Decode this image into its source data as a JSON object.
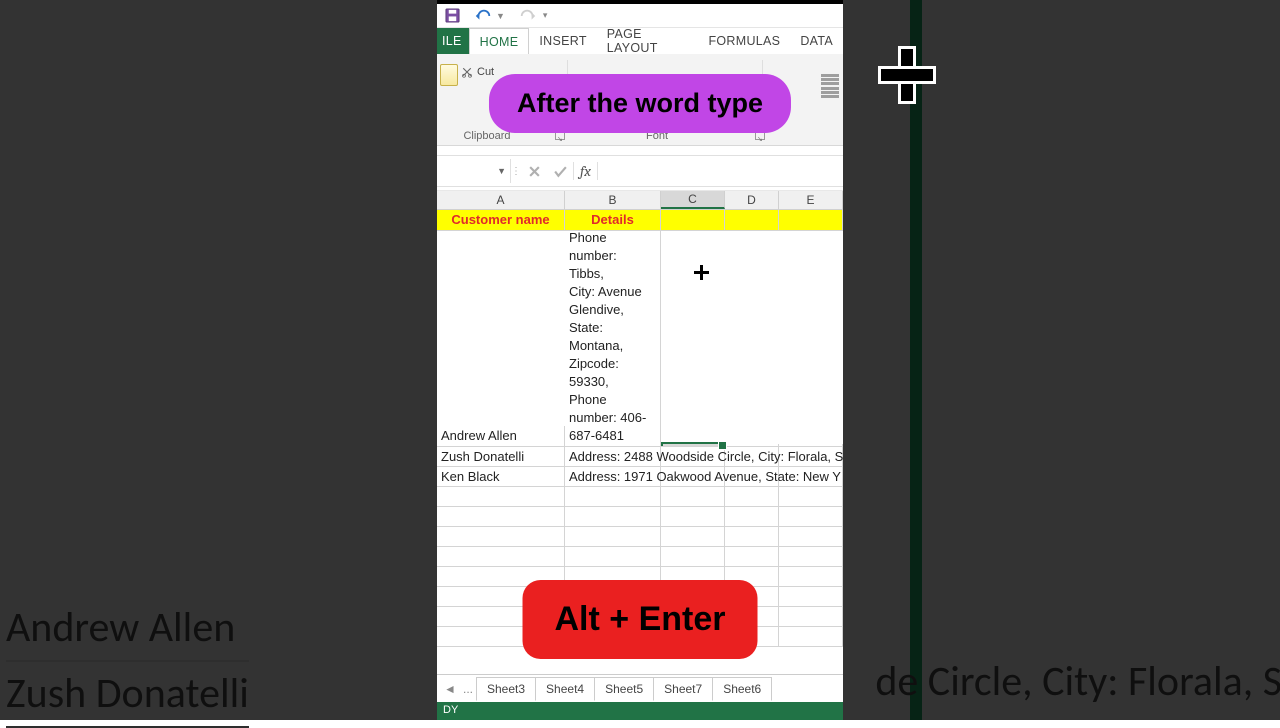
{
  "qat": {
    "save": "Save",
    "undo": "Undo",
    "redo": "Redo"
  },
  "tabs": {
    "file": "ILE",
    "home": "HOME",
    "insert": "INSERT",
    "page_layout": "PAGE LAYOUT",
    "formulas": "FORMULAS",
    "data": "DATA"
  },
  "ribbon": {
    "cut": "Cut",
    "clipboard": "Clipboard",
    "font": "Font"
  },
  "formula_bar": {
    "namebox": "",
    "value": "",
    "fx": "fx"
  },
  "columns": {
    "A": "A",
    "B": "B",
    "C": "C",
    "D": "D",
    "E": "E"
  },
  "headers": {
    "A": "Customer name",
    "B": "Details"
  },
  "rows": [
    {
      "A": "Andrew Allen",
      "B": "Phone number:\nTibbs,\nCity: Avenue\nGlendive,\nState:\nMontana,\nZipcode:\n59330,\nPhone\nnumber: 406-\n687-6481"
    },
    {
      "A": "Zush Donatelli",
      "B": "Address: 2488 Woodside Circle, City: Florala, S"
    },
    {
      "A": "Ken Black",
      "B": "Address: 1971 Oakwood Avenue, State: New Y"
    }
  ],
  "sheets": {
    "ellipsis": "...",
    "list": [
      "Sheet3",
      "Sheet4",
      "Sheet5",
      "Sheet7",
      "Sheet6"
    ]
  },
  "status": "DY",
  "overlays": {
    "top": "After the word type",
    "bottom": "Alt  +  Enter"
  },
  "backdrop": {
    "names": [
      "Andrew Allen",
      "Zush Donatelli"
    ],
    "right_fragment": "de Circle, City: Florala, S"
  }
}
